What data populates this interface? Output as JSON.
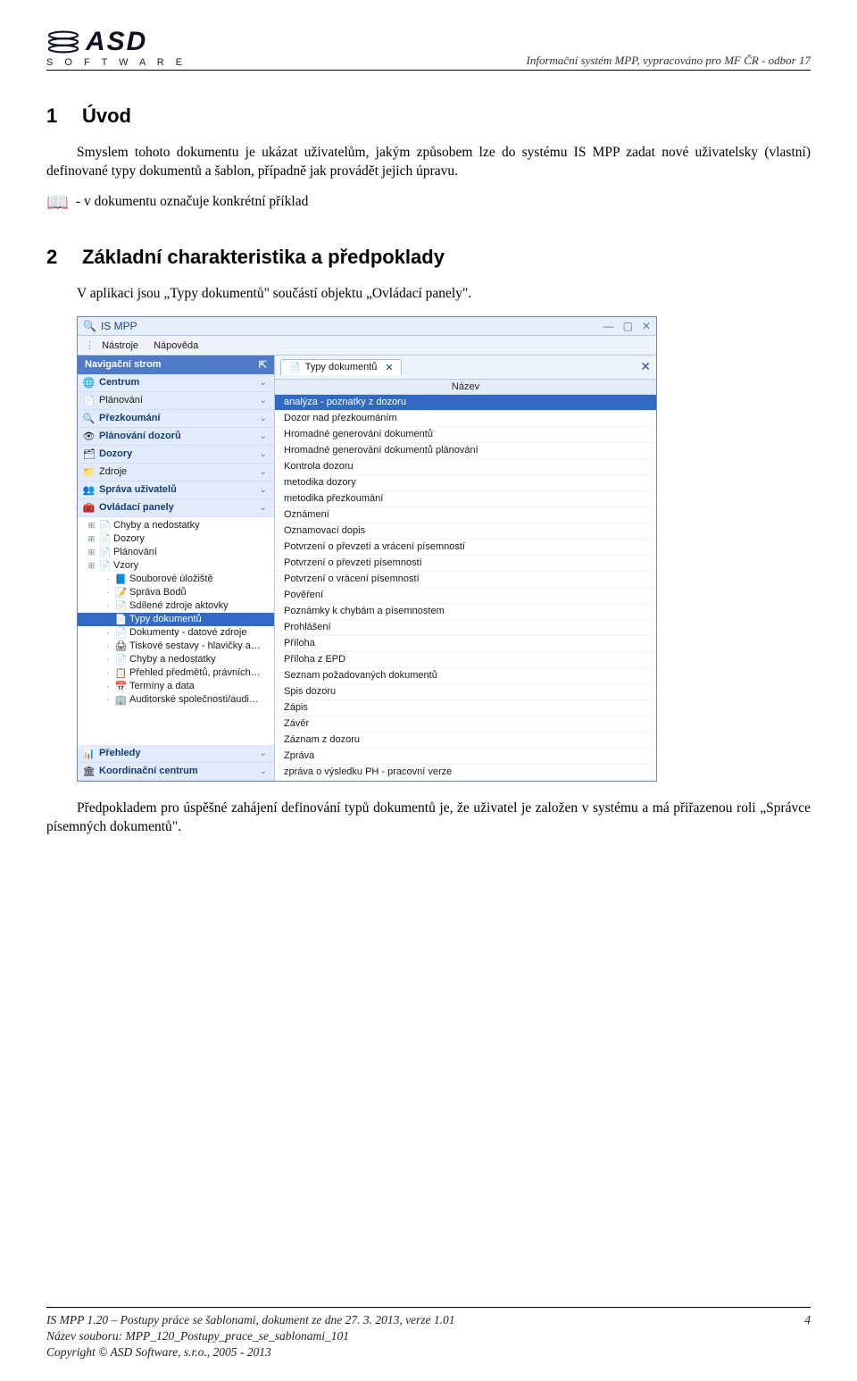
{
  "logo": {
    "main": "ASD",
    "sub": "S O F T W A R E"
  },
  "header_right": "Informační systém MPP, vypracováno pro MF ČR - odbor 17",
  "sec1": {
    "num": "1",
    "title": "Úvod",
    "para": "Smyslem tohoto dokumentu je ukázat uživatelům, jakým způsobem lze do systému IS MPP zadat nové uživatelsky (vlastní) definované typy dokumentů a šablon, případně jak provádět jejich úpravu.",
    "note": "- v dokumentu označuje konkrétní příklad"
  },
  "sec2": {
    "num": "2",
    "title": "Základní charakteristika a předpoklady",
    "para": "V aplikaci jsou „Typy dokumentů\" součástí objektu „Ovládací panely\"."
  },
  "app": {
    "title": "IS MPP",
    "menu": {
      "tools": "Nástroje",
      "help": "Nápověda"
    },
    "nav_title": "Navigační strom",
    "sections": [
      {
        "label": "Centrum",
        "bold": true,
        "icon": "🌐"
      },
      {
        "label": "Plánování",
        "bold": false,
        "icon": "📄"
      },
      {
        "label": "Přezkoumání",
        "bold": true,
        "icon": "🔍"
      },
      {
        "label": "Plánování dozorů",
        "bold": true,
        "icon": "👁"
      },
      {
        "label": "Dozory",
        "bold": true,
        "icon": "🗂"
      },
      {
        "label": "Zdroje",
        "bold": false,
        "icon": "📁"
      },
      {
        "label": "Správa uživatelů",
        "bold": true,
        "icon": "👥"
      },
      {
        "label": "Ovládací panely",
        "bold": true,
        "icon": "🧰"
      }
    ],
    "tree": [
      {
        "label": "Chyby a nedostatky",
        "depth": 1,
        "exp": "+",
        "icon": "📄",
        "sel": false
      },
      {
        "label": "Dozory",
        "depth": 1,
        "exp": "+",
        "icon": "📄",
        "sel": false
      },
      {
        "label": "Plánování",
        "depth": 1,
        "exp": "+",
        "icon": "📄",
        "sel": false
      },
      {
        "label": "Vzory",
        "depth": 1,
        "exp": "+",
        "icon": "📄",
        "sel": false
      },
      {
        "label": "Souborové úložiště",
        "depth": 2,
        "exp": "",
        "icon": "📘",
        "sel": false
      },
      {
        "label": "Správa Bodů",
        "depth": 2,
        "exp": "",
        "icon": "📝",
        "sel": false
      },
      {
        "label": "Sdílené zdroje aktovky",
        "depth": 2,
        "exp": "",
        "icon": "📄",
        "sel": false
      },
      {
        "label": "Typy dokumentů",
        "depth": 2,
        "exp": "",
        "icon": "📄",
        "sel": true
      },
      {
        "label": "Dokumenty - datové zdroje",
        "depth": 2,
        "exp": "",
        "icon": "📄",
        "sel": false
      },
      {
        "label": "Tiskové sestavy - hlavičky a…",
        "depth": 2,
        "exp": "",
        "icon": "🖨",
        "sel": false
      },
      {
        "label": "Chyby a nedostatky",
        "depth": 2,
        "exp": "",
        "icon": "📄",
        "sel": false
      },
      {
        "label": "Přehled předmětů, právních…",
        "depth": 2,
        "exp": "",
        "icon": "📋",
        "sel": false
      },
      {
        "label": "Termíny a data",
        "depth": 2,
        "exp": "",
        "icon": "📅",
        "sel": false
      },
      {
        "label": "Auditorské společnosti/audi…",
        "depth": 2,
        "exp": "",
        "icon": "🏢",
        "sel": false
      }
    ],
    "sections_tail": [
      {
        "label": "Přehledy",
        "bold": true,
        "icon": "📊"
      },
      {
        "label": "Koordinační centrum",
        "bold": true,
        "icon": "🏛"
      }
    ],
    "tab": {
      "label": "Typy dokumentů",
      "icon": "📄"
    },
    "grid_header": "Název",
    "rows": [
      {
        "label": "analýza - poznatky z dozoru",
        "sel": true
      },
      {
        "label": "Dozor nad přezkoumáním",
        "sel": false
      },
      {
        "label": "Hromadné generování dokumentů",
        "sel": false
      },
      {
        "label": "Hromadné generování dokumentů plánování",
        "sel": false
      },
      {
        "label": "Kontrola dozoru",
        "sel": false
      },
      {
        "label": "metodika dozory",
        "sel": false
      },
      {
        "label": "metodika přezkoumání",
        "sel": false
      },
      {
        "label": "Oznámení",
        "sel": false
      },
      {
        "label": "Oznamovací dopis",
        "sel": false
      },
      {
        "label": "Potvrzení o převzetí a vrácení písemností",
        "sel": false
      },
      {
        "label": "Potvrzení o převzetí písemností",
        "sel": false
      },
      {
        "label": "Potvrzení o vrácení písemností",
        "sel": false
      },
      {
        "label": "Pověření",
        "sel": false
      },
      {
        "label": "Poznámky k chybám a písemnostem",
        "sel": false
      },
      {
        "label": "Prohlášení",
        "sel": false
      },
      {
        "label": "Příloha",
        "sel": false
      },
      {
        "label": "Příloha z EPD",
        "sel": false
      },
      {
        "label": "Seznam požadovaných dokumentů",
        "sel": false
      },
      {
        "label": "Spis dozoru",
        "sel": false
      },
      {
        "label": "Zápis",
        "sel": false
      },
      {
        "label": "Závěr",
        "sel": false
      },
      {
        "label": "Záznam z dozoru",
        "sel": false
      },
      {
        "label": "Zpráva",
        "sel": false
      },
      {
        "label": "zpráva o výsledku PH - pracovní verze",
        "sel": false
      }
    ]
  },
  "after_shot": "Předpokladem pro úspěšné zahájení definování typů dokumentů je, že uživatel je založen v systému a má přiřazenou roli „Správce písemných dokumentů\".",
  "footer": {
    "line1": "IS MPP 1.20 – Postupy práce se šablonami, dokument ze dne 27. 3. 2013, verze 1.01",
    "page": "4",
    "line2": "Název souboru: MPP_120_Postupy_prace_se_sablonami_101",
    "line3": "Copyright © ASD Software, s.r.o., 2005 - 2013"
  }
}
